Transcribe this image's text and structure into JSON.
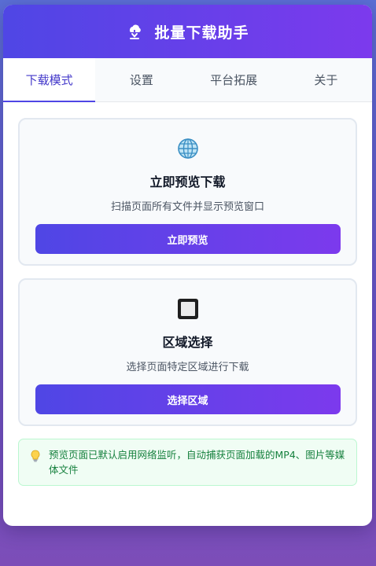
{
  "header": {
    "title": "批量下载助手",
    "icon": "download-cloud-icon"
  },
  "tabs": [
    {
      "label": "下载模式",
      "active": true
    },
    {
      "label": "设置",
      "active": false
    },
    {
      "label": "平台拓展",
      "active": false
    },
    {
      "label": "关于",
      "active": false
    }
  ],
  "cards": [
    {
      "icon": "globe-icon",
      "title": "立即预览下载",
      "description": "扫描页面所有文件并显示预览窗口",
      "button_label": "立即预览"
    },
    {
      "icon": "square-select-icon",
      "title": "区域选择",
      "description": "选择页面特定区域进行下载",
      "button_label": "选择区域"
    }
  ],
  "tip": {
    "icon": "lightbulb-icon",
    "text": "预览页面已默认启用网络监听，自动捕获页面加载的MP4、图片等媒体文件"
  },
  "colors": {
    "accent_start": "#4f46e5",
    "accent_end": "#7c3aed",
    "tip_bg": "#f0fdf4",
    "tip_text": "#15803d"
  }
}
